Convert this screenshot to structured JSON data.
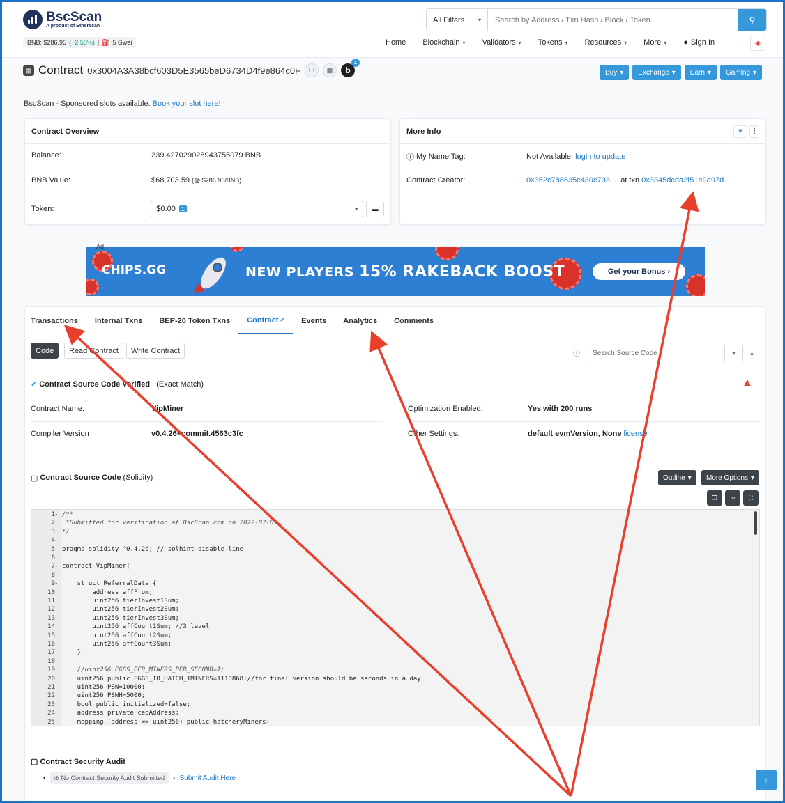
{
  "header": {
    "logo": "BscScan",
    "logo_sub": "A product of Etherscan",
    "bnb_price": "BNB: $286.95",
    "bnb_change": "(+2.58%)",
    "gas_sep": "|",
    "gas": "5 Gwei",
    "filter": "All Filters",
    "search_placeholder": "Search by Address / Txn Hash / Block / Token"
  },
  "nav": {
    "home": "Home",
    "blockchain": "Blockchain",
    "validators": "Validators",
    "tokens": "Tokens",
    "resources": "Resources",
    "more": "More",
    "signin": "Sign In"
  },
  "contract": {
    "label": "Contract",
    "address": "0x3004A3A38bcf603D5E3565beD6734D4f9e864c0F",
    "b_letter": "b",
    "b_count": "1"
  },
  "top_buttons": {
    "buy": "Buy",
    "exchange": "Exchange",
    "earn": "Earn",
    "gaming": "Gaming"
  },
  "sponsor": {
    "text": "BscScan - Sponsored slots available.",
    "link": "Book your slot here!"
  },
  "overview": {
    "title": "Contract Overview",
    "balance_label": "Balance:",
    "balance": "239.427029028943755079 BNB",
    "value_label": "BNB Value:",
    "value": "$68,703.59",
    "value_rate": "(@ $286.95/BNB)",
    "token_label": "Token:",
    "token_value": "$0.00",
    "token_count": "1"
  },
  "moreinfo": {
    "title": "More Info",
    "tag_label": "My Name Tag:",
    "tag_value": "Not Available,",
    "tag_link": "login to update",
    "creator_label": "Contract Creator:",
    "creator": "0x352c788635c430c793...",
    "at_txn": "at txn",
    "txn": "0x3345dcda2f51e9a97d..."
  },
  "ad": {
    "tag": "Ad",
    "logo": "CHIPS.GG",
    "title_a": "NEW PLAYERS",
    "title_b": "15% RAKEBACK BOOST",
    "button": "Get your Bonus"
  },
  "tabs": [
    "Transactions",
    "Internal Txns",
    "BEP-20 Token Txns",
    "Contract",
    "Events",
    "Analytics",
    "Comments"
  ],
  "subtabs": {
    "code": "Code",
    "read": "Read Contract",
    "write": "Write Contract",
    "search_placeholder": "Search Source Code"
  },
  "verified": {
    "title": "Contract Source Code Verified",
    "match": "(Exact Match)",
    "name_label": "Contract Name:",
    "name": "VipMiner",
    "compiler_label": "Compiler Version",
    "compiler": "v0.4.26+commit.4563c3fc",
    "opt_label": "Optimization Enabled:",
    "opt": "Yes with 200 runs",
    "other_label": "Other Settings:",
    "other": "default evmVersion, None",
    "license": "license"
  },
  "source": {
    "title": "Contract Source Code",
    "lang": "(Solidity)",
    "outline": "Outline",
    "more_options": "More Options"
  },
  "code_lines": [
    {
      "n": "1",
      "fold": "▾",
      "t": "/**"
    },
    {
      "n": "2",
      "fold": "",
      "t": " *Submitted for verification at BscScan.com on 2022-07-01"
    },
    {
      "n": "3",
      "fold": "",
      "t": "*/"
    },
    {
      "n": "4",
      "fold": "",
      "t": ""
    },
    {
      "n": "5",
      "fold": "",
      "t": "pragma solidity ^0.4.26; // solhint-disable-line"
    },
    {
      "n": "6",
      "fold": "",
      "t": ""
    },
    {
      "n": "7",
      "fold": "▾",
      "t": "contract VipMiner{"
    },
    {
      "n": "8",
      "fold": "",
      "t": ""
    },
    {
      "n": "9",
      "fold": "▾",
      "t": "    struct ReferralData {"
    },
    {
      "n": "10",
      "fold": "",
      "t": "        address affFrom;"
    },
    {
      "n": "11",
      "fold": "",
      "t": "        uint256 tierInvest1Sum;"
    },
    {
      "n": "12",
      "fold": "",
      "t": "        uint256 tierInvest2Sum;"
    },
    {
      "n": "13",
      "fold": "",
      "t": "        uint256 tierInvest3Sum;"
    },
    {
      "n": "14",
      "fold": "",
      "t": "        uint256 affCount1Sum; //3 level"
    },
    {
      "n": "15",
      "fold": "",
      "t": "        uint256 affCount2Sum;"
    },
    {
      "n": "16",
      "fold": "",
      "t": "        uint256 affCount3Sum;"
    },
    {
      "n": "17",
      "fold": "",
      "t": "    }"
    },
    {
      "n": "18",
      "fold": "",
      "t": ""
    },
    {
      "n": "19",
      "fold": "",
      "t": "    //uint256 EGGS_PER_MINERS_PER_SECOND=1;"
    },
    {
      "n": "20",
      "fold": "",
      "t": "    uint256 public EGGS_TO_HATCH_1MINERS=1110868;//for final version should be seconds in a day"
    },
    {
      "n": "21",
      "fold": "",
      "t": "    uint256 PSN=10000;"
    },
    {
      "n": "22",
      "fold": "",
      "t": "    uint256 PSNH=5000;"
    },
    {
      "n": "23",
      "fold": "",
      "t": "    bool public initialized=false;"
    },
    {
      "n": "24",
      "fold": "",
      "t": "    address private ceoAddress;"
    },
    {
      "n": "25",
      "fold": "",
      "t": "    mapping (address => uint256) public hatcheryMiners;"
    }
  ],
  "audit": {
    "title": "Contract Security Audit",
    "badge": "No Contract Security Audit Submitted",
    "sep": "-",
    "link": "Submit Audit Here"
  },
  "colors": {
    "accent": "#3498db",
    "link": "#1f78c1",
    "arrow": "#e8402c",
    "frame": "#1a73c7"
  }
}
